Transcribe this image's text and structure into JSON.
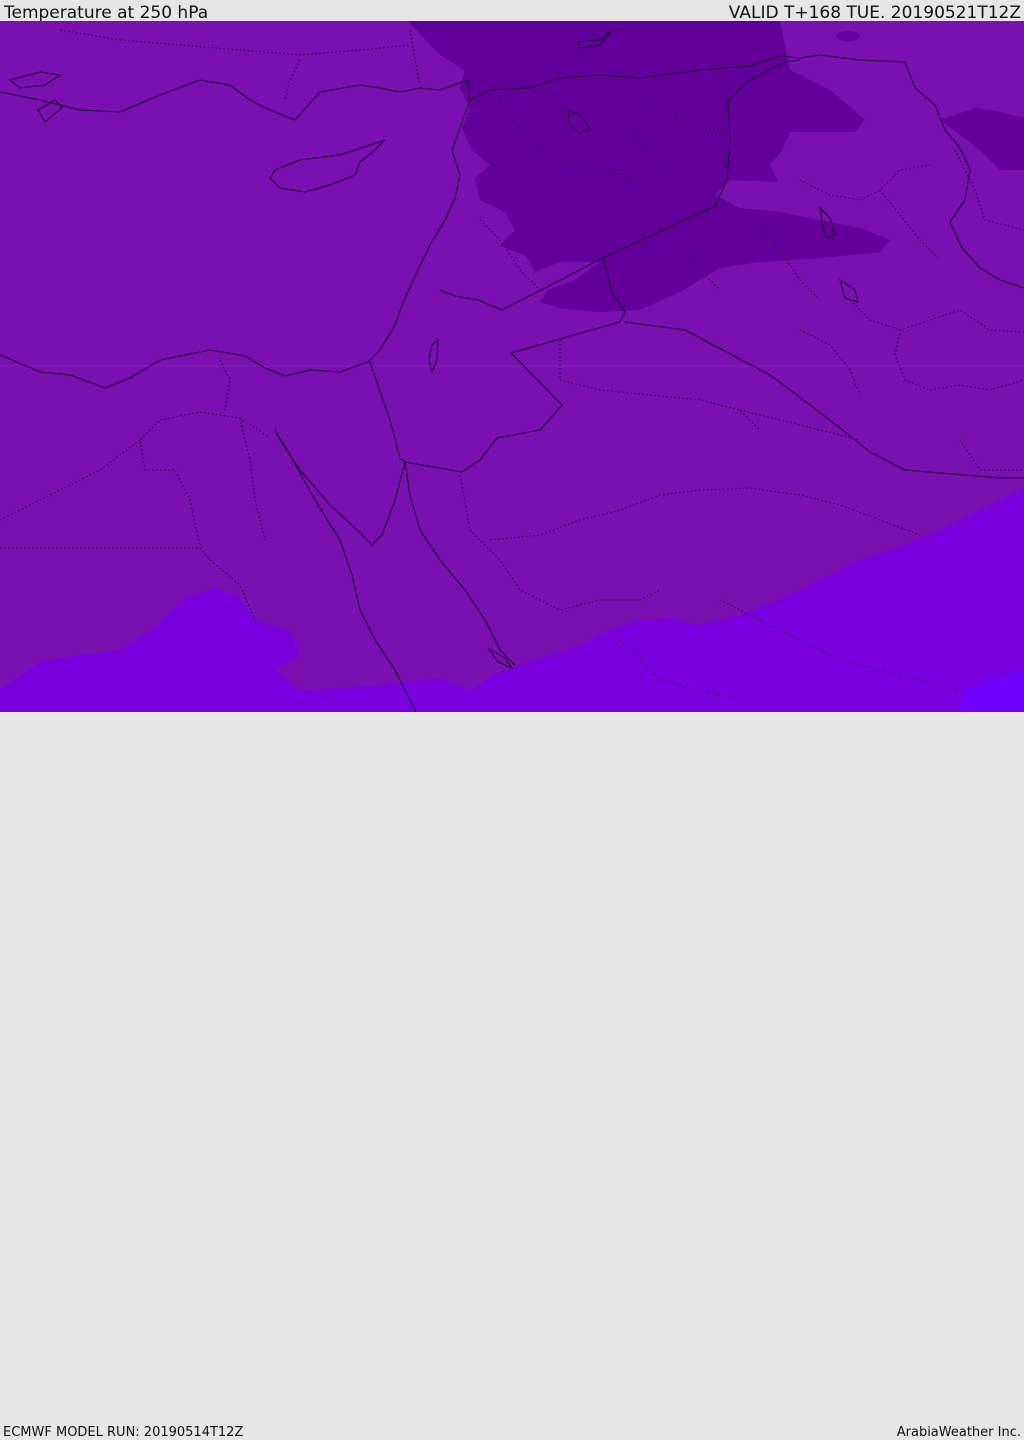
{
  "header": {
    "title": "Temperature at 250 hPa",
    "valid": "VALID T+168 TUE. 20190521T12Z"
  },
  "footer": {
    "model_run": "ECMWF MODEL RUN: 20190514T12Z",
    "credit": "ArabiaWeather Inc."
  },
  "colors": {
    "base": "#7a10b0",
    "cold": "#63009a",
    "warm": "#7a00e0",
    "warmest": "#7000ff",
    "lines": "#1a0030"
  }
}
